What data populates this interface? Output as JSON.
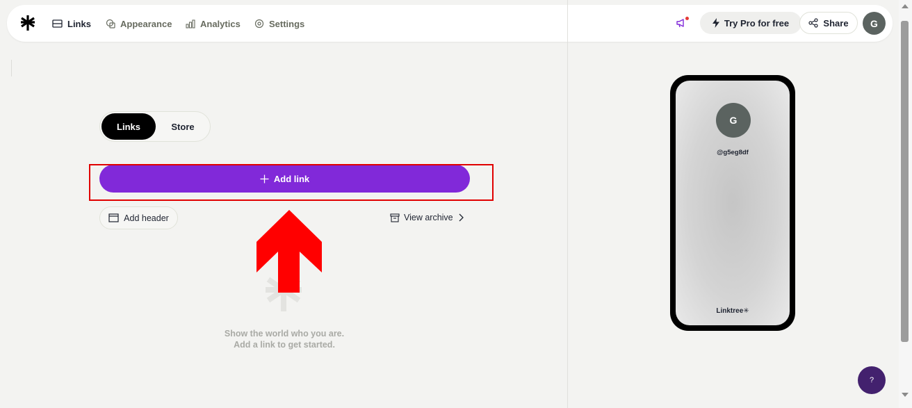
{
  "nav": {
    "links": "Links",
    "appearance": "Appearance",
    "analytics": "Analytics",
    "settings": "Settings",
    "try_pro": "Try Pro for free",
    "share": "Share",
    "avatar_initial": "G"
  },
  "tabs": {
    "links": "Links",
    "store": "Store"
  },
  "actions": {
    "add_link": "Add link",
    "add_header": "Add header",
    "view_archive": "View archive"
  },
  "empty_state": {
    "line1": "Show the world who you are.",
    "line2": "Add a link to get started."
  },
  "preview": {
    "avatar_initial": "G",
    "handle": "@g5eg8df",
    "brand": "Linktree✳"
  },
  "help": {
    "label": "?"
  },
  "colors": {
    "accent": "#8129d9",
    "highlight": "#e00000",
    "avatar": "#5b6360",
    "help": "#43216e"
  },
  "icons": [
    "linktree-logo-icon",
    "links-icon",
    "appearance-icon",
    "analytics-icon",
    "settings-icon",
    "megaphone-icon",
    "lightning-icon",
    "share-icon",
    "plus-icon",
    "header-icon",
    "archive-icon",
    "chevron-right-icon",
    "red-arrow-icon"
  ]
}
